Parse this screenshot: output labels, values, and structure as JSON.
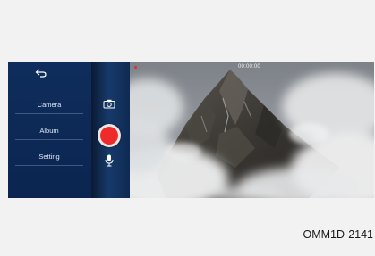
{
  "menu": {
    "items": [
      {
        "label": "Camera"
      },
      {
        "label": "Album"
      },
      {
        "label": "Setting"
      }
    ]
  },
  "icons": {
    "back": "back-arrow-icon",
    "camera": "camera-icon",
    "record": "record-button",
    "mic": "microphone-icon"
  },
  "viewfinder": {
    "timer": "00:00:00"
  },
  "caption": "OMM1D-2141",
  "colors": {
    "panel": "#0f2d5c",
    "record": "#ee2a2a"
  }
}
